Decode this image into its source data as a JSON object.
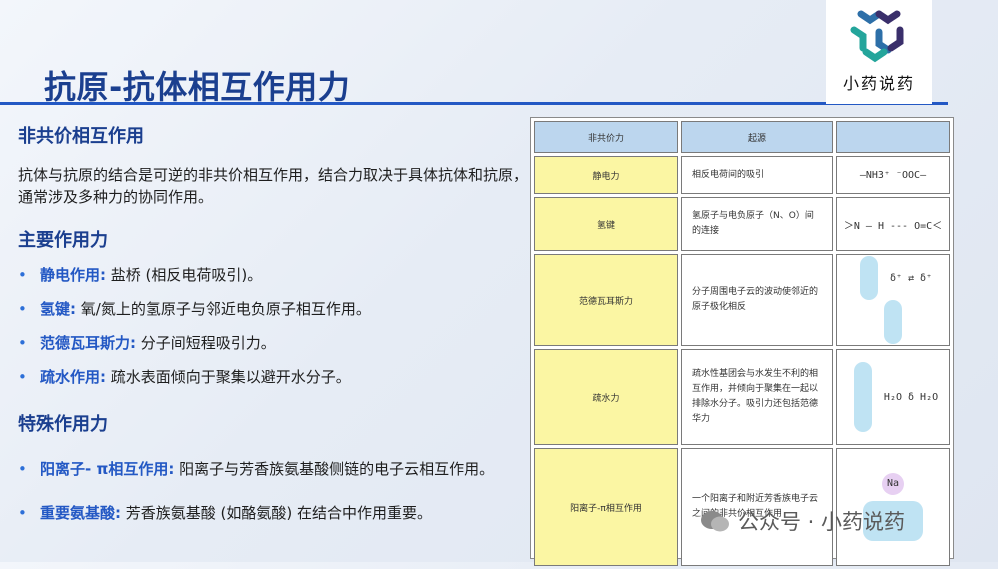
{
  "header": {
    "title": "抗原-抗体相互作用力",
    "logo_text": "小药说药"
  },
  "content": {
    "section1_heading": "非共价相互作用",
    "section1_text": "抗体与抗原的结合是可逆的非共价相互作用，结合力取决于具体抗体和抗原，通常涉及多种力的协同作用。",
    "section2_heading": "主要作用力",
    "forces": [
      {
        "kw": "静电作用:",
        "text": " 盐桥 (相反电荷吸引)。"
      },
      {
        "kw": "氢键:",
        "text": " 氧/氮上的氢原子与邻近电负原子相互作用。"
      },
      {
        "kw": "范德瓦耳斯力:",
        "text": " 分子间短程吸引力。"
      },
      {
        "kw": "疏水作用:",
        "text": " 疏水表面倾向于聚集以避开水分子。"
      }
    ],
    "section3_heading": "特殊作用力",
    "special": [
      {
        "kw": "阳离子- π相互作用:",
        "text": " 阳离子与芳香族氨基酸侧链的电子云相互作用。"
      },
      {
        "kw": "重要氨基酸:",
        "text": " 芳香族氨基酸 (如酪氨酸) 在结合中作用重要。"
      }
    ]
  },
  "table": {
    "headers": [
      "非共价力",
      "起源",
      ""
    ],
    "rows": [
      {
        "name": "静电力",
        "origin": "相反电荷间的吸引",
        "diagram": "—NH3⁺   ⁻OOC—"
      },
      {
        "name": "氢键",
        "origin": "氢原子与电负原子（N、O）间的连接",
        "diagram": "＞N — H --- O=C＜"
      },
      {
        "name": "范德瓦耳斯力",
        "origin": "分子周围电子云的波动使邻近的原子极化相反",
        "diagram": "δ⁺ ⇄ δ⁺"
      },
      {
        "name": "疏水力",
        "origin": "疏水性基团会与水发生不利的相互作用，并倾向于聚集在一起以排除水分子。吸引力还包括范德华力",
        "diagram": "H₂O  δ  H₂O"
      },
      {
        "name": "阳离子-π相互作用",
        "origin": "一个阳离子和附近芳香族电子云之间的非共价相互作用",
        "diagram": "Na"
      }
    ]
  },
  "watermark": {
    "text": "公众号 · 小药说药"
  },
  "colors": {
    "title": "#1b3f8f",
    "accent_line": "#2358c4",
    "keyword": "#2358c4",
    "table_header": "#bcd6ee",
    "table_name_col": "#fbf6a3"
  }
}
